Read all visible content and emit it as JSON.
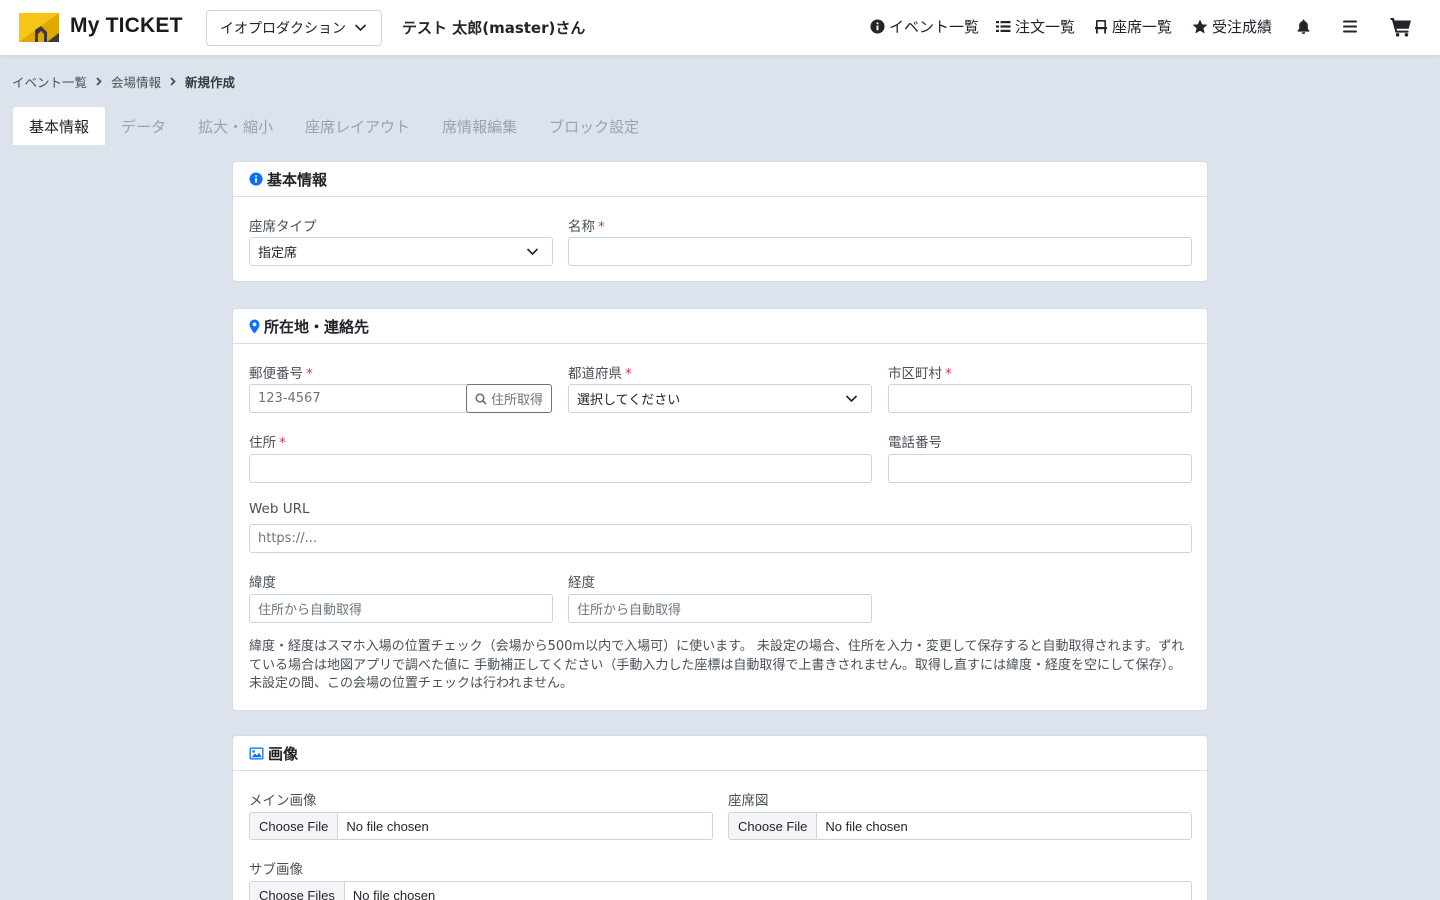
{
  "header": {
    "brand": "My TICKET",
    "org_select": "イオプロダクション",
    "user_name": "テスト 太郎(master)さん",
    "nav": {
      "events": "イベント一覧",
      "orders": "注文一覧",
      "seats": "座席一覧",
      "results": "受注成績"
    },
    "accent_colors": {
      "logo_yellow": "#f5c518",
      "logo_dark": "#3a3a3a"
    }
  },
  "breadcrumb": [
    "イベント一覧",
    "会場情報",
    "新規作成"
  ],
  "tabs": [
    {
      "label": "基本情報",
      "active": true
    },
    {
      "label": "データ",
      "active": false
    },
    {
      "label": "拡大・縮小",
      "active": false
    },
    {
      "label": "座席レイアウト",
      "active": false
    },
    {
      "label": "席情報編集",
      "active": false
    },
    {
      "label": "ブロック設定",
      "active": false
    }
  ],
  "basic": {
    "title": "基本情報",
    "seat_type_label": "座席タイプ",
    "seat_type_value": "指定席",
    "name_label": "名称",
    "name_value": ""
  },
  "location": {
    "title": "所在地・連絡先",
    "postal_label": "郵便番号",
    "postal_placeholder": "123-4567",
    "address_lookup_button": "住所取得",
    "prefecture_label": "都道府県",
    "prefecture_value": "選択してください",
    "city_label": "市区町村",
    "address_label": "住所",
    "phone_label": "電話番号",
    "url_label": "Web URL",
    "url_placeholder": "https://...",
    "lat_label": "緯度",
    "lat_placeholder": "住所から自動取得",
    "lng_label": "経度",
    "lng_placeholder": "住所から自動取得",
    "note_line1": "緯度・経度はスマホ入場の位置チェック（会場から500m以内で入場可）に使います。 未設定の場合、住所を入力・変更して保存すると自動取得されます。ずれ",
    "note_line2": "ている場合は地図アプリで調べた値に 手動補正してください（手動入力した座標は自動取得で上書きされません。取得し直すには緯度・経度を空にして保存）。",
    "note_line3": "未設定の間、この会場の位置チェックは行われません。"
  },
  "images": {
    "title": "画像",
    "main_label": "メイン画像",
    "seatmap_label": "座席図",
    "sub_label": "サブ画像",
    "choose_file": "Choose File",
    "choose_files": "Choose Files",
    "no_file": "No file chosen"
  },
  "required_mark": "*"
}
